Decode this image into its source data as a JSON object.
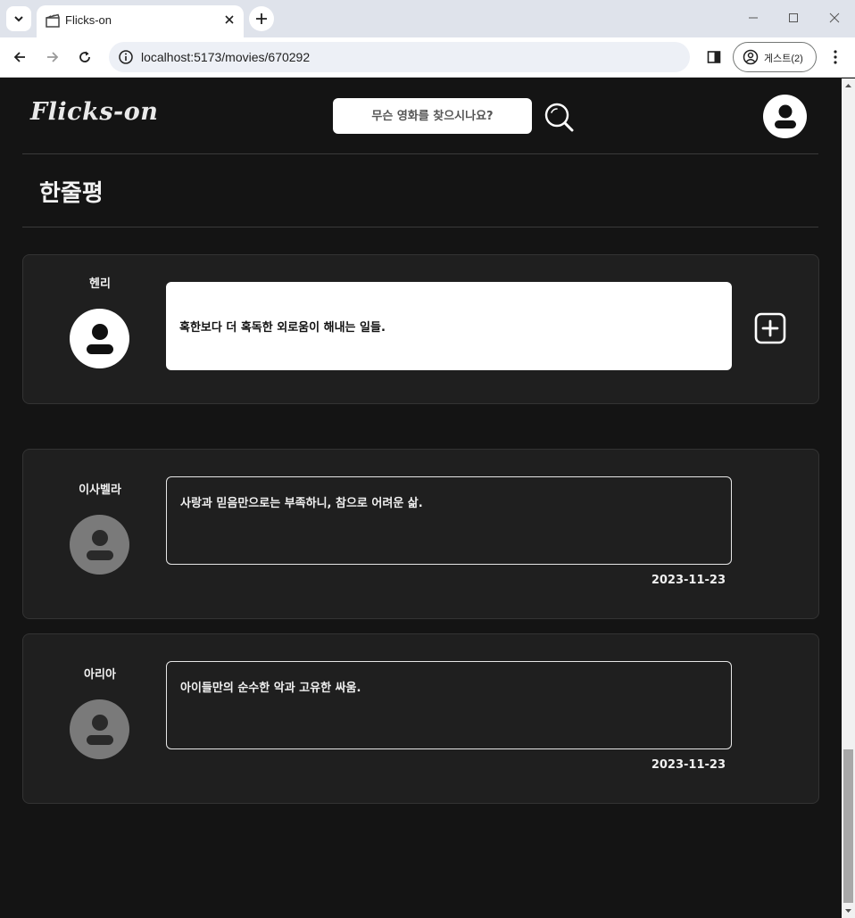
{
  "browser": {
    "tab_title": "Flicks-on",
    "url": "localhost:5173/movies/670292",
    "profile_label": "게스트(2)",
    "icons": {
      "tab_search": "chevron-down-icon",
      "favicon": "clapperboard-icon",
      "tab_close": "close-icon",
      "new_tab": "plus-icon",
      "back": "arrow-left-icon",
      "forward": "arrow-right-icon",
      "reload": "reload-icon",
      "site_info": "info-icon",
      "side_panel": "side-panel-icon",
      "profile": "person-circle-icon",
      "menu": "kebab-menu-icon"
    }
  },
  "header": {
    "logo": "Flicks-on",
    "search_placeholder": "무슨 영화를 찾으시나요?"
  },
  "section": {
    "title": "한줄평"
  },
  "my_review": {
    "user_name": "헨리",
    "text": "혹한보다 더 혹독한 외로움이 해내는 일들."
  },
  "reviews": [
    {
      "user_name": "이사벨라",
      "text": "사랑과 믿음만으로는 부족하니, 참으로 어려운 삶.",
      "date": "2023-11-23"
    },
    {
      "user_name": "아리아",
      "text": "아이들만의 순수한 악과 고유한 싸움.",
      "date": "2023-11-23"
    }
  ],
  "colors": {
    "page_bg": "#141414",
    "card_bg": "#1f1f1f",
    "text": "#f0f0f0",
    "avatar_gray": "#7a7a7a"
  }
}
